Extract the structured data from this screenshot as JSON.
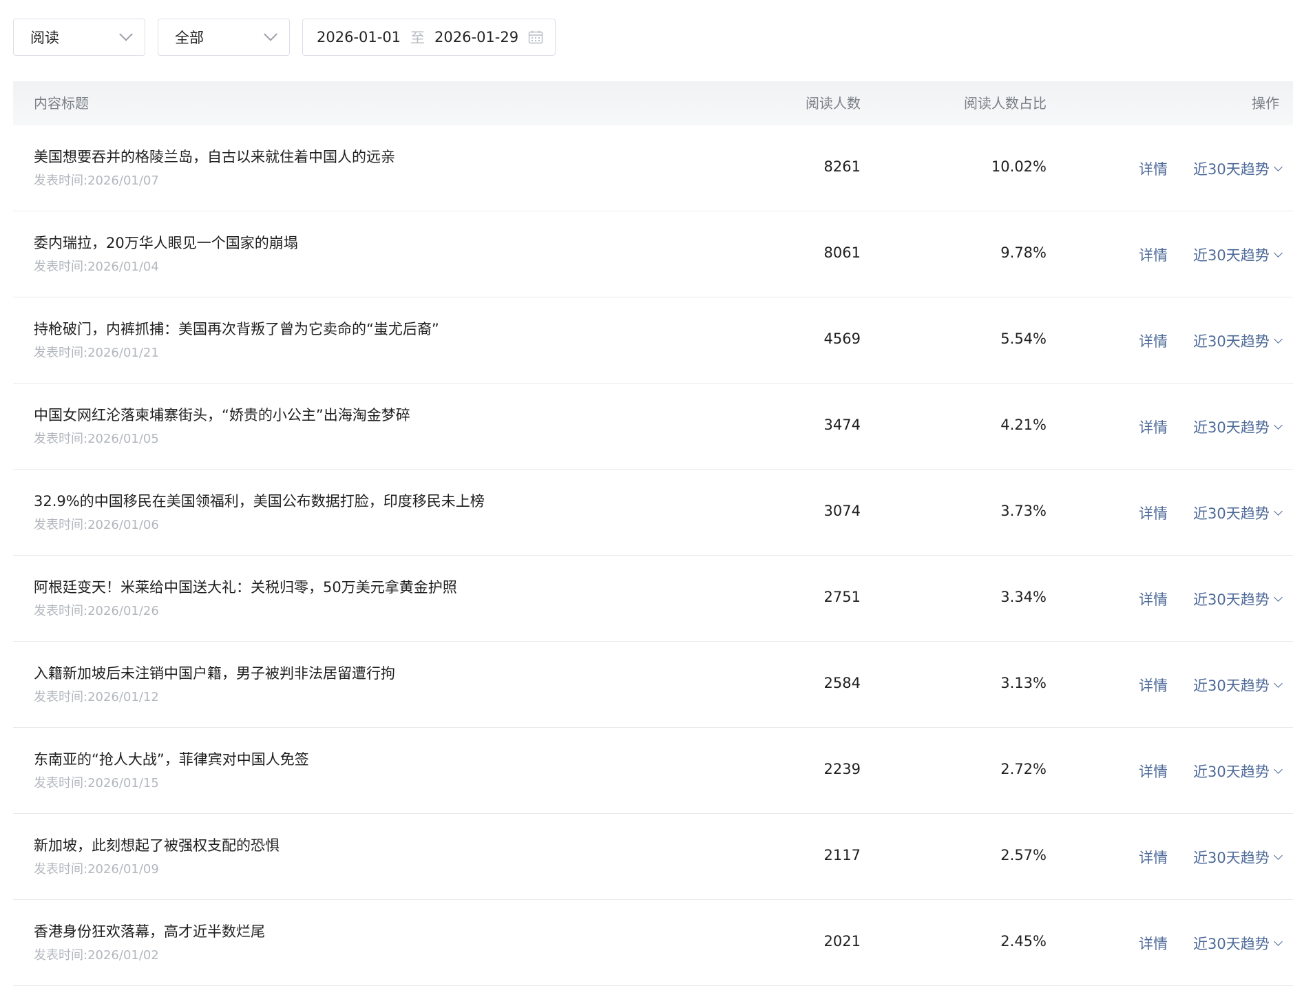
{
  "filters": {
    "type_select": "阅读",
    "scope_select": "全部",
    "date_start": "2026-01-01",
    "date_separator": "至",
    "date_end": "2026-01-29"
  },
  "table": {
    "headers": {
      "title": "内容标题",
      "readers": "阅读人数",
      "ratio": "阅读人数占比",
      "ops": "操作"
    },
    "date_label": "发表时间:",
    "detail_label": "详情",
    "trend_label": "近30天趋势",
    "rows": [
      {
        "title": "美国想要吞并的格陵兰岛，自古以来就住着中国人的远亲",
        "date": "2026/01/07",
        "readers": "8261",
        "ratio": "10.02%"
      },
      {
        "title": "委内瑞拉，20万华人眼见一个国家的崩塌",
        "date": "2026/01/04",
        "readers": "8061",
        "ratio": "9.78%"
      },
      {
        "title": "持枪破门，内裤抓捕：美国再次背叛了曾为它卖命的“蚩尤后裔”",
        "date": "2026/01/21",
        "readers": "4569",
        "ratio": "5.54%"
      },
      {
        "title": "中国女网红沦落柬埔寨街头，“娇贵的小公主”出海淘金梦碎",
        "date": "2026/01/05",
        "readers": "3474",
        "ratio": "4.21%"
      },
      {
        "title": "32.9%的中国移民在美国领福利，美国公布数据打脸，印度移民未上榜",
        "date": "2026/01/06",
        "readers": "3074",
        "ratio": "3.73%"
      },
      {
        "title": "阿根廷变天！米莱给中国送大礼：关税归零，50万美元拿黄金护照",
        "date": "2026/01/26",
        "readers": "2751",
        "ratio": "3.34%"
      },
      {
        "title": "入籍新加坡后未注销中国户籍，男子被判非法居留遭行拘",
        "date": "2026/01/12",
        "readers": "2584",
        "ratio": "3.13%"
      },
      {
        "title": "东南亚的“抢人大战”，菲律宾对中国人免签",
        "date": "2026/01/15",
        "readers": "2239",
        "ratio": "2.72%"
      },
      {
        "title": "新加坡，此刻想起了被强权支配的恐惧",
        "date": "2026/01/09",
        "readers": "2117",
        "ratio": "2.57%"
      },
      {
        "title": "香港身份狂欢落幕，高才近半数烂尾",
        "date": "2026/01/02",
        "readers": "2021",
        "ratio": "2.45%"
      }
    ]
  },
  "colors": {
    "link": "#4d6a98",
    "muted_text": "#b3b7bd",
    "header_bg": "#f1f2f4"
  }
}
